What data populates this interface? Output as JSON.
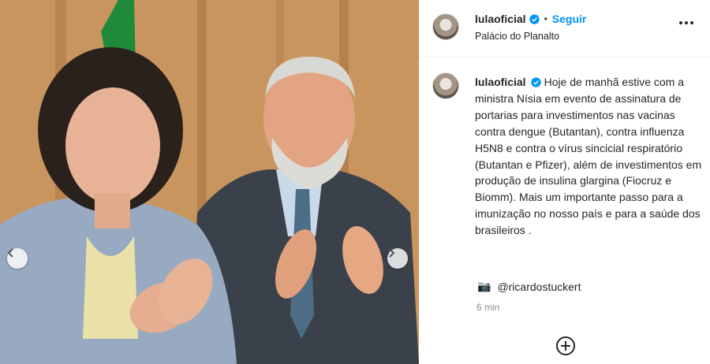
{
  "post": {
    "username": "lulaoficial",
    "follow_label": "Seguir",
    "separator": "•",
    "location": "Palácio do Planalto",
    "caption_text": "Hoje de manhã estive com a ministra Nísia em evento de assinatura de portarias para investimentos nas vacinas contra dengue (Butantan), contra influenza H5N8 e contra o vírus sincicial respiratório (Butantan e Pfizer), além de investimentos em produção de insulina glargina (Fiocruz e Biomm). Mais um importante passo para a imunização no nosso país e para a saúde dos brasileiros .",
    "credit_emoji": "📷",
    "credit_handle": "@ricardostuckert",
    "timestamp": "6 min"
  },
  "icons": {
    "verified": "verified-badge-icon",
    "more": "more-options-icon",
    "prev": "chevron-left-icon",
    "next": "chevron-right-icon",
    "add": "plus-circle-icon"
  },
  "colors": {
    "accent": "#0095f6",
    "text": "#262626",
    "muted": "#8e8e8e"
  }
}
